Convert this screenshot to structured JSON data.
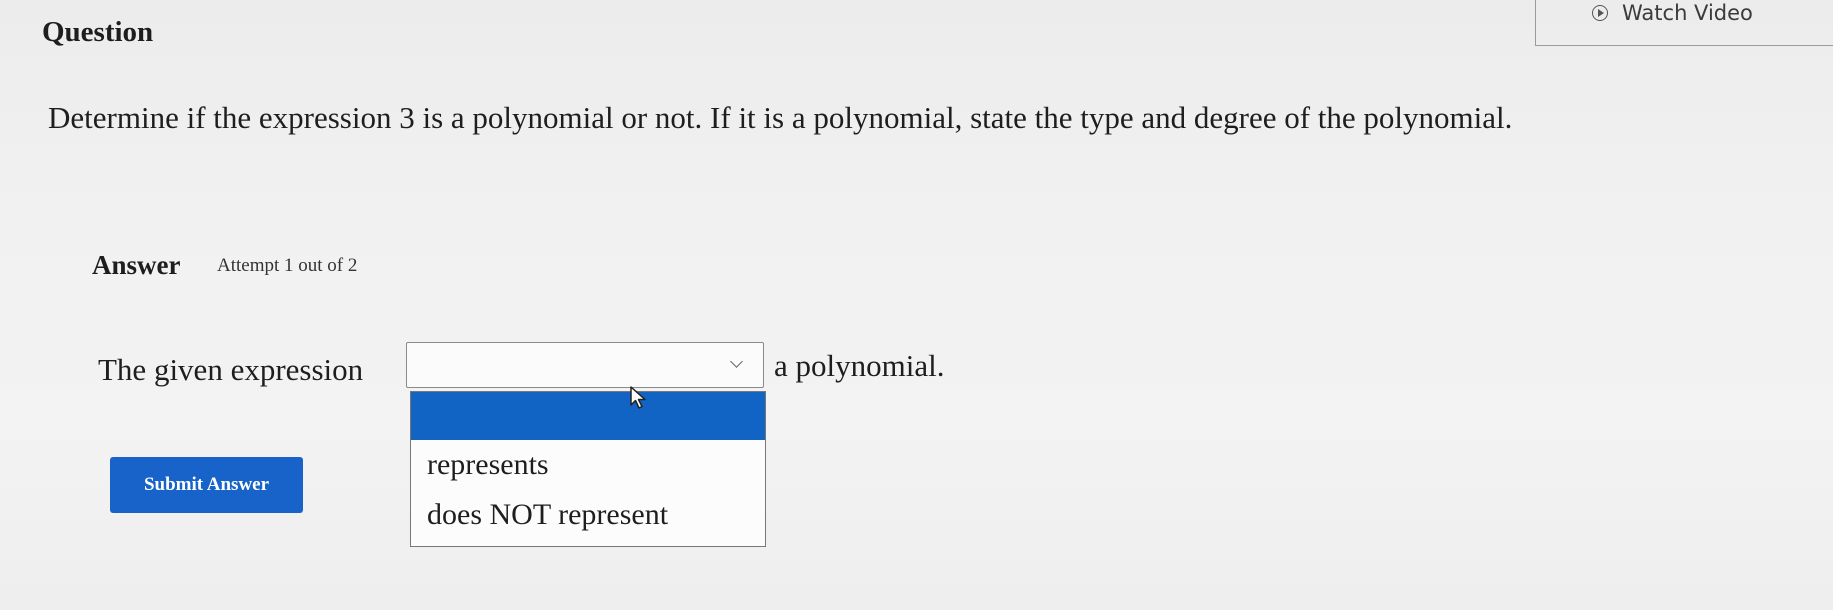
{
  "header": {
    "question_title": "Question",
    "watch_video_label": "Watch Video"
  },
  "question": {
    "text": "Determine if the expression 3 is a polynomial or not. If it is a polynomial, state the type and degree of the polynomial."
  },
  "answer": {
    "title": "Answer",
    "attempt_text": "Attempt 1 out of 2",
    "sentence_prefix": "The given expression",
    "sentence_suffix": "a polynomial.",
    "select": {
      "selected": "",
      "options": [
        "",
        "represents",
        "does NOT represent"
      ]
    },
    "submit_label": "Submit Answer"
  },
  "colors": {
    "accent": "#1763c9",
    "highlight": "#1164c4"
  },
  "icons": {
    "watch_video": "play-circle-icon",
    "select": "chevron-down-icon",
    "cursor": "mouse-pointer-icon"
  }
}
